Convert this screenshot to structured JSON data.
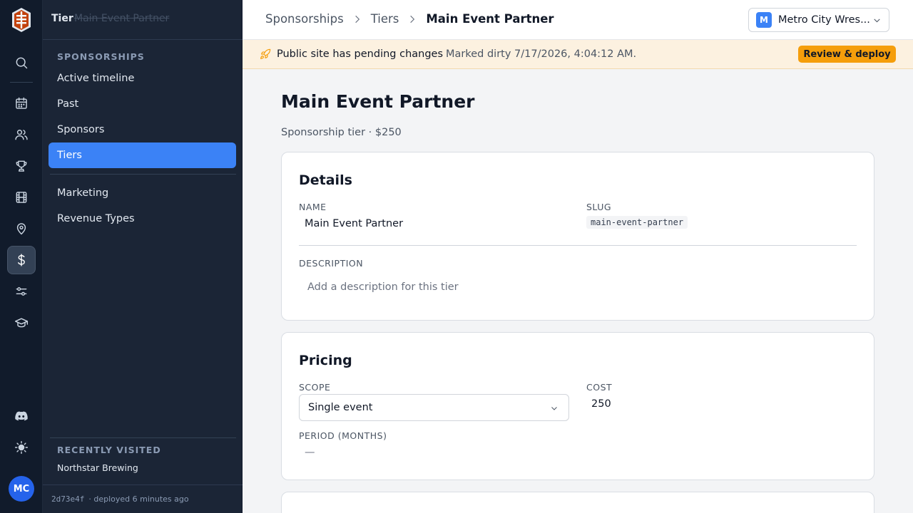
{
  "app": {
    "title": "Tier",
    "title_ghost": "Main Event Partner"
  },
  "rail": {
    "items": [
      {
        "name": "search-icon"
      },
      {
        "name": "calendar-icon"
      },
      {
        "name": "users-icon"
      },
      {
        "name": "trophy-icon"
      },
      {
        "name": "film-icon"
      },
      {
        "name": "map-pin-icon"
      },
      {
        "name": "dollar-icon",
        "active": true
      },
      {
        "name": "sliders-icon"
      },
      {
        "name": "graduation-cap-icon"
      },
      {
        "name": "discord-icon"
      },
      {
        "name": "sun-icon"
      }
    ],
    "avatar_initials": "MC"
  },
  "sidebar": {
    "section": "SPONSORSHIPS",
    "items": [
      {
        "label": "Active timeline"
      },
      {
        "label": "Past"
      },
      {
        "label": "Sponsors"
      },
      {
        "label": "Tiers",
        "active": true
      },
      {
        "label": "Marketing"
      },
      {
        "label": "Revenue Types"
      }
    ],
    "recent_title": "RECENTLY VISITED",
    "recent_items": [
      "Northstar Brewing"
    ],
    "footer": {
      "hash": "2d73e4f",
      "deployed": "· deployed 6 minutes ago"
    }
  },
  "breadcrumb": {
    "items": [
      "Sponsorships",
      "Tiers"
    ],
    "current": "Main Event Partner"
  },
  "org": {
    "initial": "M",
    "name": "Metro City Wres..."
  },
  "banner": {
    "message": "Public site has pending changes",
    "meta": "Marked dirty 7/17/2026, 4:04:12 AM.",
    "button": "Review & deploy"
  },
  "page": {
    "title": "Main Event Partner",
    "subtitle": "Sponsorship tier · $250"
  },
  "details": {
    "heading": "Details",
    "name_label": "NAME",
    "name_value": "Main Event Partner",
    "slug_label": "SLUG",
    "slug_value": "main-event-partner",
    "description_label": "DESCRIPTION",
    "description_placeholder": "Add a description for this tier"
  },
  "pricing": {
    "heading": "Pricing",
    "scope_label": "SCOPE",
    "scope_value": "Single event",
    "cost_label": "COST",
    "cost_value": "250",
    "period_label": "PERIOD (MONTHS)",
    "period_value": "—"
  },
  "colors": {
    "accent": "#3b82f6",
    "warning": "#f59e0b",
    "rail_bg": "#111b2b",
    "sidebar_bg": "#1b2536"
  }
}
